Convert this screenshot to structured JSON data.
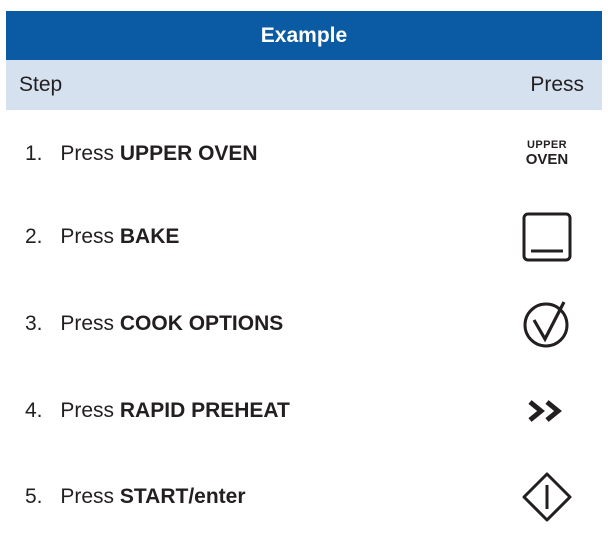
{
  "title": "Example",
  "header": {
    "step": "Step",
    "press": "Press"
  },
  "rows": [
    {
      "num": "1.",
      "prefix": "Press",
      "label": "UPPER OVEN",
      "icon": "upper-oven-text-icon",
      "icon_text": [
        "UPPER",
        "OVEN"
      ]
    },
    {
      "num": "2.",
      "prefix": "Press",
      "label": "BAKE",
      "icon": "bake-square-icon"
    },
    {
      "num": "3.",
      "prefix": "Press",
      "label": "COOK OPTIONS",
      "icon": "check-circle-icon"
    },
    {
      "num": "4.",
      "prefix": "Press",
      "label": "RAPID PREHEAT",
      "icon": "double-chevron-right-icon"
    },
    {
      "num": "5.",
      "prefix": "Press",
      "label": "START/enter",
      "icon": "start-diamond-icon"
    }
  ],
  "colors": {
    "title_bg": "#0b5ba4",
    "header_bg": "#d6e1f0",
    "text": "#231f20"
  }
}
